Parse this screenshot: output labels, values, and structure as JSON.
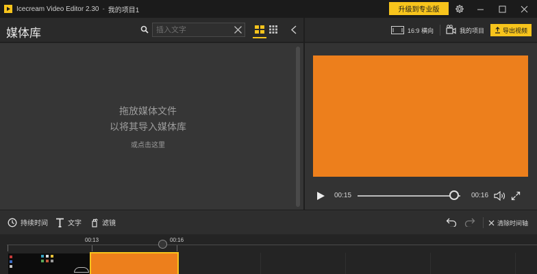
{
  "window": {
    "app_title": "Icecream Video Editor 2.30",
    "separator": "-",
    "project_title": "我的项目1",
    "upgrade_label": "升级到专业版",
    "settings_icon": "gear-icon",
    "minimize_icon": "minimize-icon",
    "maximize_icon": "maximize-icon",
    "close_icon": "close-icon"
  },
  "library": {
    "title": "媒体库",
    "search_placeholder": "插入文字",
    "drop_hint_line1": "拖放媒体文件",
    "drop_hint_line2": "以将其导入媒体库",
    "drop_hint_line3": "或点击这里"
  },
  "preview_toolbar": {
    "aspect_label": "16:9 横向",
    "project_label": "我的项目",
    "export_label": "导出视频"
  },
  "player": {
    "current_time": "00:15",
    "total_time": "00:16",
    "progress": 0.94,
    "video_color": "#ed7f1c"
  },
  "timeline_toolbar": {
    "duration_label": "持续时间",
    "text_label": "文字",
    "filter_label": "滤镜",
    "clear_label": "清除时间轴"
  },
  "timeline": {
    "ruler_labels": [
      "00:13",
      "00:16"
    ]
  },
  "colors": {
    "accent": "#f7c41c",
    "orange": "#ed7f1c"
  }
}
